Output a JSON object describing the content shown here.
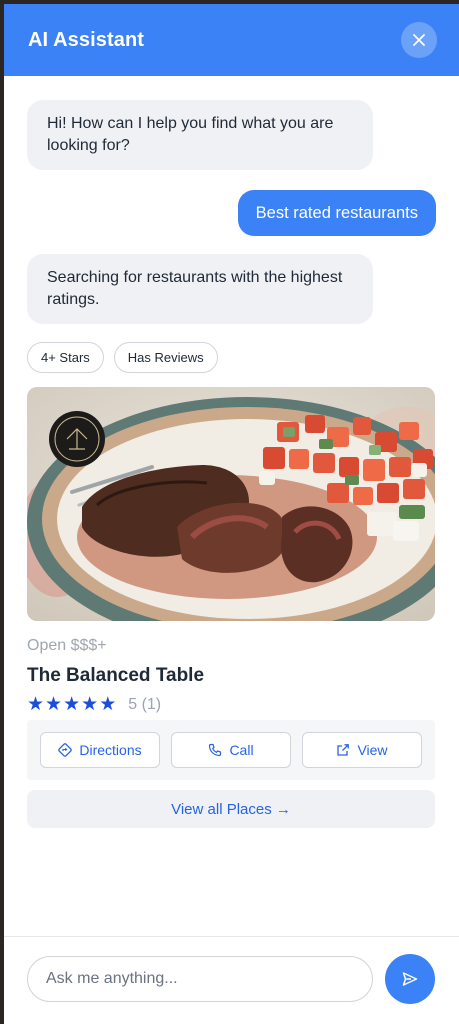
{
  "header": {
    "title": "AI Assistant",
    "close_icon": "close-icon"
  },
  "messages": [
    {
      "role": "assistant",
      "text": "Hi! How can I help you find what you are looking for?"
    },
    {
      "role": "user",
      "text": "Best rated restaurants"
    },
    {
      "role": "assistant",
      "text": "Searching for restaurants with the highest ratings."
    }
  ],
  "filters": [
    "4+ Stars",
    "Has Reviews"
  ],
  "place": {
    "status": "Open $$$+",
    "name": "The Balanced Table",
    "rating_text": "5 (1)",
    "rating_value": 5,
    "rating_max": 5,
    "image": "steak-with-tomato-salad-photo",
    "actions": [
      {
        "label": "Directions",
        "icon": "directions-icon"
      },
      {
        "label": "Call",
        "icon": "phone-icon"
      },
      {
        "label": "View",
        "icon": "external-link-icon"
      }
    ]
  },
  "view_all_label": "View all Places →",
  "composer": {
    "placeholder": "Ask me anything...",
    "send_icon": "send-icon"
  },
  "colors": {
    "primary": "#3b82f6",
    "link": "#2563eb",
    "star": "#1d4ed8",
    "bubble_bg": "#f0f1f4"
  }
}
